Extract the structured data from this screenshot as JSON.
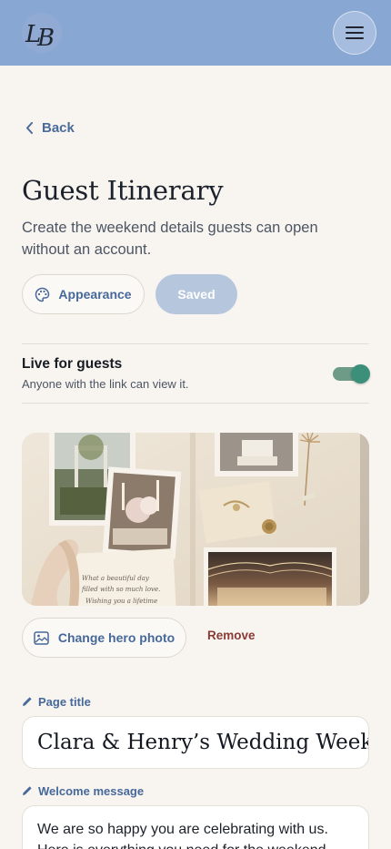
{
  "header": {
    "logo_text": "LB",
    "menu_icon": "hamburger-icon"
  },
  "nav": {
    "back_label": "Back"
  },
  "page": {
    "title": "Guest Itinerary",
    "subtitle": "Create the weekend details guests can open without an account."
  },
  "actions": {
    "appearance_label": "Appearance",
    "saved_label": "Saved"
  },
  "live": {
    "title": "Live for guests",
    "subtitle": "Anyone with the link can view it.",
    "enabled": true
  },
  "hero": {
    "note_line1": "What a beautiful day",
    "note_line2": "filled with so much love.",
    "note_line3": "Wishing you a lifetime",
    "change_label": "Change hero photo",
    "remove_label": "Remove"
  },
  "fields": {
    "page_title_label": "Page title",
    "page_title_value": "Clara & Henry’s Wedding Week",
    "welcome_label": "Welcome message",
    "welcome_value": "We are so happy you are celebrating with us. Here is everything you need for the weekend."
  },
  "colors": {
    "header_bg": "#89a7d3",
    "accent_blue": "#46689a",
    "toggle_green": "#3c8f79",
    "remove_red": "#8b3a35",
    "page_bg": "#f8f5f1"
  }
}
